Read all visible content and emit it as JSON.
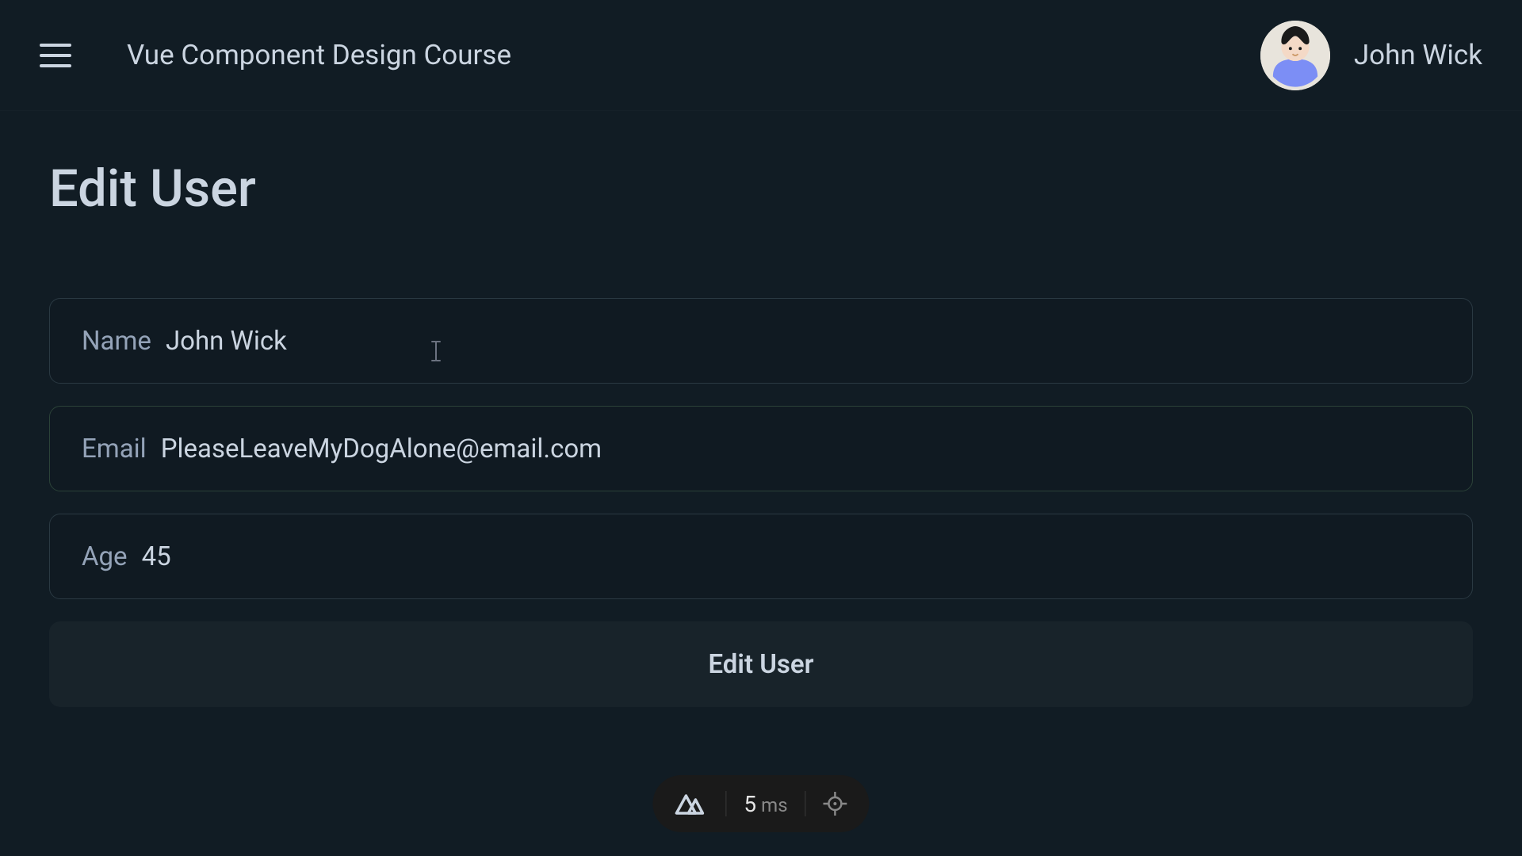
{
  "header": {
    "title": "Vue Component Design Course",
    "username": "John Wick"
  },
  "page": {
    "title": "Edit User"
  },
  "form": {
    "name": {
      "label": "Name",
      "value": "John Wick"
    },
    "email": {
      "label": "Email",
      "value": "PleaseLeaveMyDogAlone@email.com"
    },
    "age": {
      "label": "Age",
      "value": "45"
    },
    "submit_label": "Edit User"
  },
  "devtools": {
    "timing_value": "5",
    "timing_unit": "ms"
  }
}
